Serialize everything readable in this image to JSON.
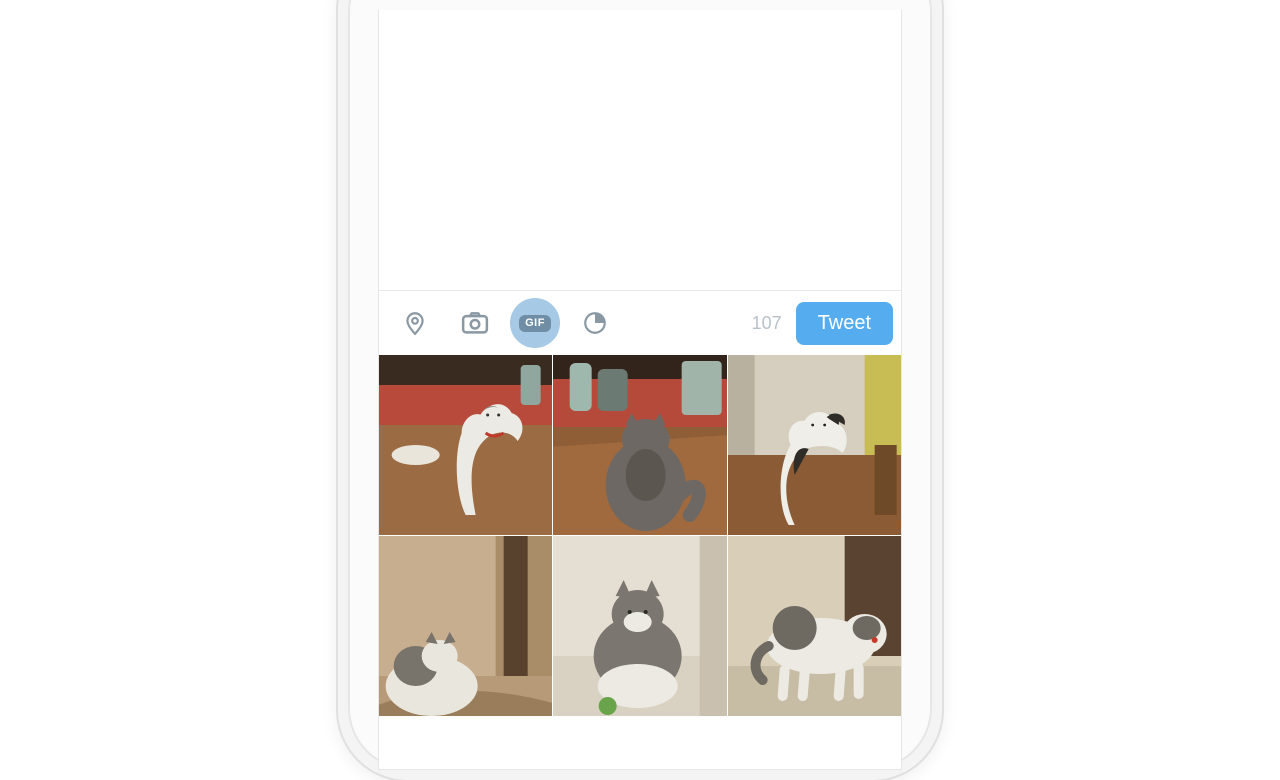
{
  "toolbar": {
    "gif_label": "GIF",
    "char_remaining": "107",
    "tweet_label": "Tweet"
  },
  "icons": {
    "location": "location-pin-icon",
    "camera": "camera-icon",
    "gif": "gif-icon",
    "poll": "pie-timer-icon"
  },
  "gallery": {
    "items": [
      {
        "alt": "white-grey cat looking up under shelf",
        "type": "photo"
      },
      {
        "alt": "grey cat on red mat facing away",
        "type": "photo"
      },
      {
        "alt": "white-black cat sitting on wood floor in kitchen",
        "type": "photo"
      },
      {
        "alt": "grey-white cat on rug near doorway",
        "type": "photo"
      },
      {
        "alt": "grey kitten with green ball on floor",
        "type": "photo"
      },
      {
        "alt": "white-grey cat walking across room",
        "type": "photo"
      }
    ]
  },
  "colors": {
    "accent": "#55acee",
    "gif_bg": "#a6c9e6",
    "icon_grey": "#8a98a4",
    "count_grey": "#b9c2c9"
  }
}
